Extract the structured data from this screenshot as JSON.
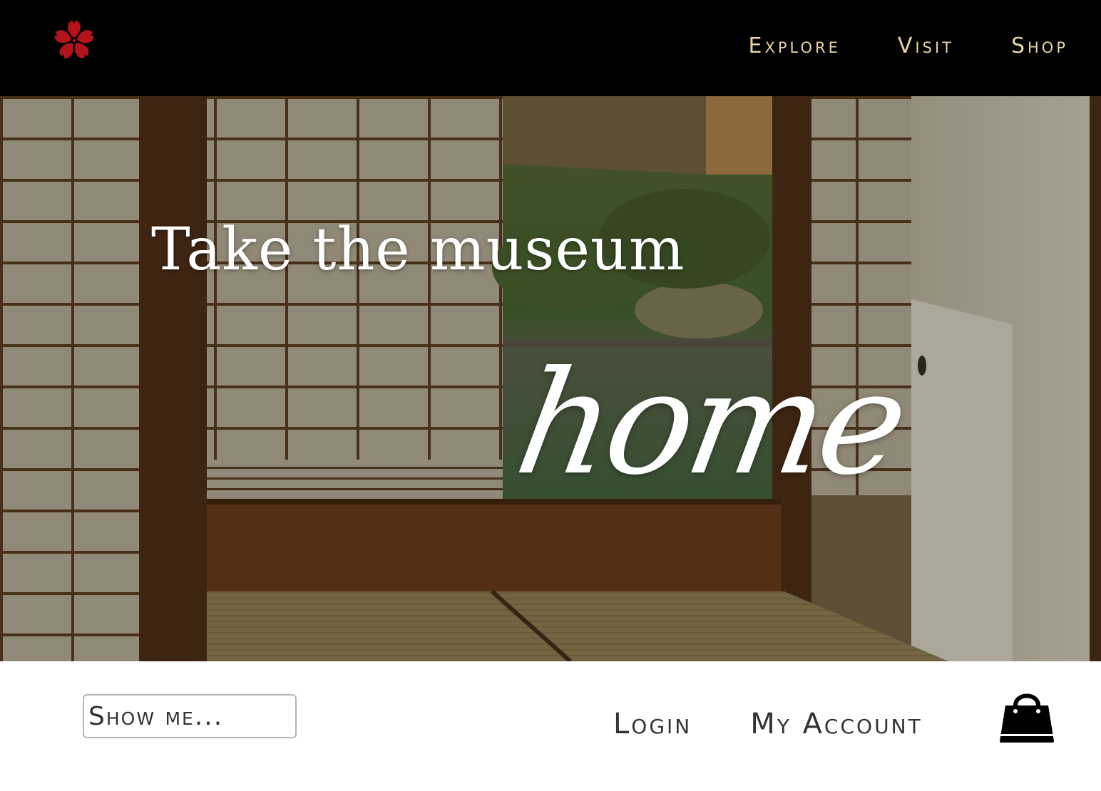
{
  "header": {
    "logo_icon": "cherry-blossom-icon",
    "logo_color": "#b3141c",
    "nav": [
      {
        "label": "Explore"
      },
      {
        "label": "Visit"
      },
      {
        "label": "Shop"
      }
    ],
    "nav_color": "#e6d3a3"
  },
  "hero": {
    "line1": "Take the museum",
    "line2": "home"
  },
  "footer": {
    "search_placeholder": "Show me...",
    "login_label": "Login",
    "account_label": "My Account",
    "cart_icon": "shopping-bag-icon"
  }
}
